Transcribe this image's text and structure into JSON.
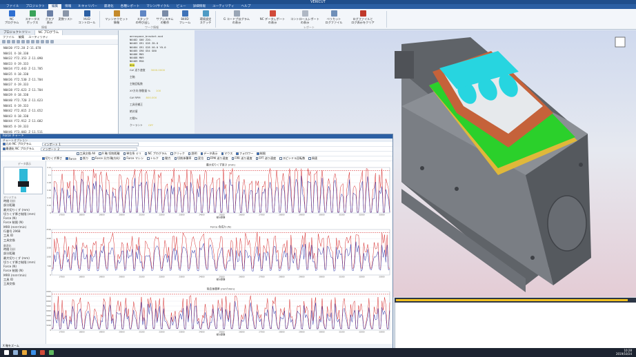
{
  "app": {
    "title": "VERICUT"
  },
  "menu": [
    "ファイル",
    "プロジェクト",
    "編集",
    "情報",
    "X-キャリパー",
    "最適化",
    "各種レポート",
    "マシン/サイクル",
    "ビュー",
    "詳細情報",
    "ユーティリティ",
    "ヘルプ"
  ],
  "menu_active": 2,
  "ribbon": {
    "buttons": [
      {
        "label": "NC\nプログラム",
        "color": "#2e6fd1"
      },
      {
        "label": "ステータス\nボックス",
        "color": "#3aa35a"
      },
      {
        "label": "グラフ\n表示",
        "color": "#6a7fa5"
      },
      {
        "label": "変数リスト",
        "color": "#8a96a8"
      },
      {
        "label": "HUD\nコントロール",
        "color": "#2b5fa3"
      },
      {
        "label": "マシンテクセット\n情報",
        "color": "#c48a2b"
      },
      {
        "label": "スタック\nの呼び出し",
        "color": "#5f86c4"
      },
      {
        "label": "サブシステム\nの動作",
        "color": "#7a8ba6"
      },
      {
        "label": "840D\nフレーム",
        "color": "#3f73b8"
      },
      {
        "label": "環境設定\nスケッチ",
        "color": "#4f9bc4"
      },
      {
        "label": "G コードプログラム\nの表示",
        "color": "#9aa6b6"
      },
      {
        "label": "NC データレポート\nの表示",
        "color": "#d14a3a"
      },
      {
        "label": "コントロールレポート\nの表示",
        "color": "#b0b8c4"
      },
      {
        "label": "ベリカット\nログファイル",
        "color": "#6f8fb8"
      },
      {
        "label": "ログファイルと\nログ表示をクリア",
        "color": "#c0392b"
      }
    ],
    "groups": [
      "情報",
      "ワーク情報",
      "レポート"
    ]
  },
  "project_panel": {
    "tabs": [
      "プロジェクトツリー",
      "NC プログラム"
    ],
    "sub_menu": [
      "ファイル",
      "編集",
      "ユーティリティ"
    ],
    "lines": [
      "N0430 Y72.28 Z-11.678",
      "N0431 X-18.330",
      "N0432 Y72.353 Z-11.090",
      "N0433 X-19.333",
      "N0434 Y72.443 Z-11.705",
      "N0435 X-18.330",
      "N0436 Y72.530 Z-11.704",
      "N0437 X-19.333",
      "N0438 Y72.623 Z-11.704",
      "N0439 X-18.330",
      "N0440 Y72.720 Z-11.623",
      "N0441 X-19.333",
      "N0442 Y72.815 Z-11.652",
      "N0443 X-18.330",
      "N0444 Y72.912 Z-11.682",
      "N0445 X-19.333",
      "N0446 Y73.003 Z-11.511"
    ]
  },
  "nc_info": {
    "file": "aerospace_bracket.mcd",
    "lines": [
      "N0482 G00 Z20.",
      "N0483 G91 G28 Z0.0",
      "N0484 G91 G28 X0.0 Y0.0",
      "N0485 G90 G54 G80",
      "N0486 M05",
      "N0488 M09",
      "N0489 M30"
    ],
    "highlight": "M30",
    "labels": [
      {
        "k": "G# 送り速度",
        "v": "3000.0000"
      },
      {
        "k": "主軸",
        "v": ""
      },
      {
        "k": "主軸回転数",
        "v": ""
      },
      {
        "k": "XY方向 移動量 %",
        "v": "100"
      },
      {
        "k": "G# RPM",
        "v": "800.000"
      },
      {
        "k": "工具径補正",
        "v": ""
      },
      {
        "k": "絶対値",
        "v": ""
      },
      {
        "k": "刃間%",
        "v": ""
      },
      {
        "k": "クーラント",
        "v": "OFF"
      }
    ]
  },
  "force": {
    "title": "Force チャート",
    "options_label": "チャートオプション",
    "row1": {
      "left_label": "元の NC プログラム",
      "field": "インポート 1"
    },
    "row2": {
      "left_label": "最適化 NC プログラム",
      "field": "インポート 2"
    },
    "row3": [
      "工具交換 All",
      "X 軸 切削距離",
      "単位系 ミリ",
      "NC プログラム",
      "クリック",
      "説明",
      "データ表示",
      "マウス",
      "フォロワー",
      "制限"
    ],
    "row4": [
      "切りくず厚さ",
      "Force",
      "削り",
      "Force 分力(軸方向)",
      "Force マシン",
      "トルク",
      "動力",
      "切削体積率",
      "変位",
      "FPM 送り速度",
      "FPR 送り速度",
      "FPT 送り速度",
      "スピンドル回転数",
      "周速"
    ],
    "row4_checked": [
      0,
      1
    ],
    "data_panel_label": "データ表示",
    "original_head": "オリジナル",
    "original_stats": [
      "時間 (分)",
      "部分距離",
      "最大切りくず (mm)",
      "切りくず厚さ制限 (mm)",
      "Force (N)",
      "Force 制限 (N)",
      "MRR (mm³/min)",
      "行番号 2968",
      "工具 ID",
      "工具交換"
    ],
    "optimized_head": "最適化",
    "optimized_stats": [
      "時間 (分)",
      "部分距離",
      "最大切りくず (mm)",
      "切りくず厚さ制限 (mm)",
      "Force (N)",
      "Force 制限 (N)",
      "MRR (mm³/min)",
      "工具 ID",
      "工具交換"
    ],
    "bottom": "X 軸をズーム"
  },
  "chart_data": [
    {
      "type": "line",
      "title": "最大切りくず厚さ (mm)",
      "xlabel": "部分距離",
      "ylim": [
        0,
        0.12
      ],
      "yticks": [
        0,
        0.02,
        0.04,
        0.06,
        0.08,
        0.1,
        0.12
      ],
      "xticks": [
        17000,
        18000,
        19000,
        20000,
        21000,
        22000,
        23000,
        24000,
        25000,
        26000,
        27000,
        28000,
        29000,
        30000,
        31000,
        32000,
        33000
      ],
      "xlim": [
        16500,
        33400
      ],
      "series": [
        {
          "color": "#d62728"
        },
        {
          "color": "#2a2fa8"
        }
      ],
      "pattern": "chip"
    },
    {
      "type": "line",
      "title": "Force 合成力 (N)",
      "xlabel": "部分距離",
      "ylim": [
        0,
        2500
      ],
      "yticks": [
        0,
        500,
        1000,
        1500,
        2000,
        2500
      ],
      "xticks": [
        17000,
        18000,
        19000,
        20000,
        21000,
        22000,
        23000,
        24000,
        25000,
        26000,
        27000,
        28000,
        29000,
        30000,
        31000,
        32000,
        33000
      ],
      "xlim": [
        16500,
        33400
      ],
      "series": [
        {
          "color": "#d62728"
        },
        {
          "color": "#2a2fa8"
        }
      ],
      "pattern": "force"
    },
    {
      "type": "line",
      "title": "除去体積率 (mm³/min)",
      "xlabel": "部分距離",
      "ylim": [
        0,
        40000
      ],
      "yticks": [
        0,
        5000,
        10000,
        15000,
        20000,
        25000,
        30000,
        35000,
        40000
      ],
      "xticks": [
        17000,
        18000,
        19000,
        20000,
        21000,
        22000,
        23000,
        24000,
        25000,
        26000,
        27000,
        28000,
        29000,
        30000,
        31000,
        32000,
        33000
      ],
      "xlim": [
        16500,
        33400
      ],
      "series": [
        {
          "color": "#d62728"
        },
        {
          "color": "#2a2fa8"
        }
      ],
      "pattern": "mrr"
    }
  ],
  "progress": {
    "fraction": 0.97
  },
  "clock": {
    "time": "10:28",
    "date": "2019/10/24"
  }
}
